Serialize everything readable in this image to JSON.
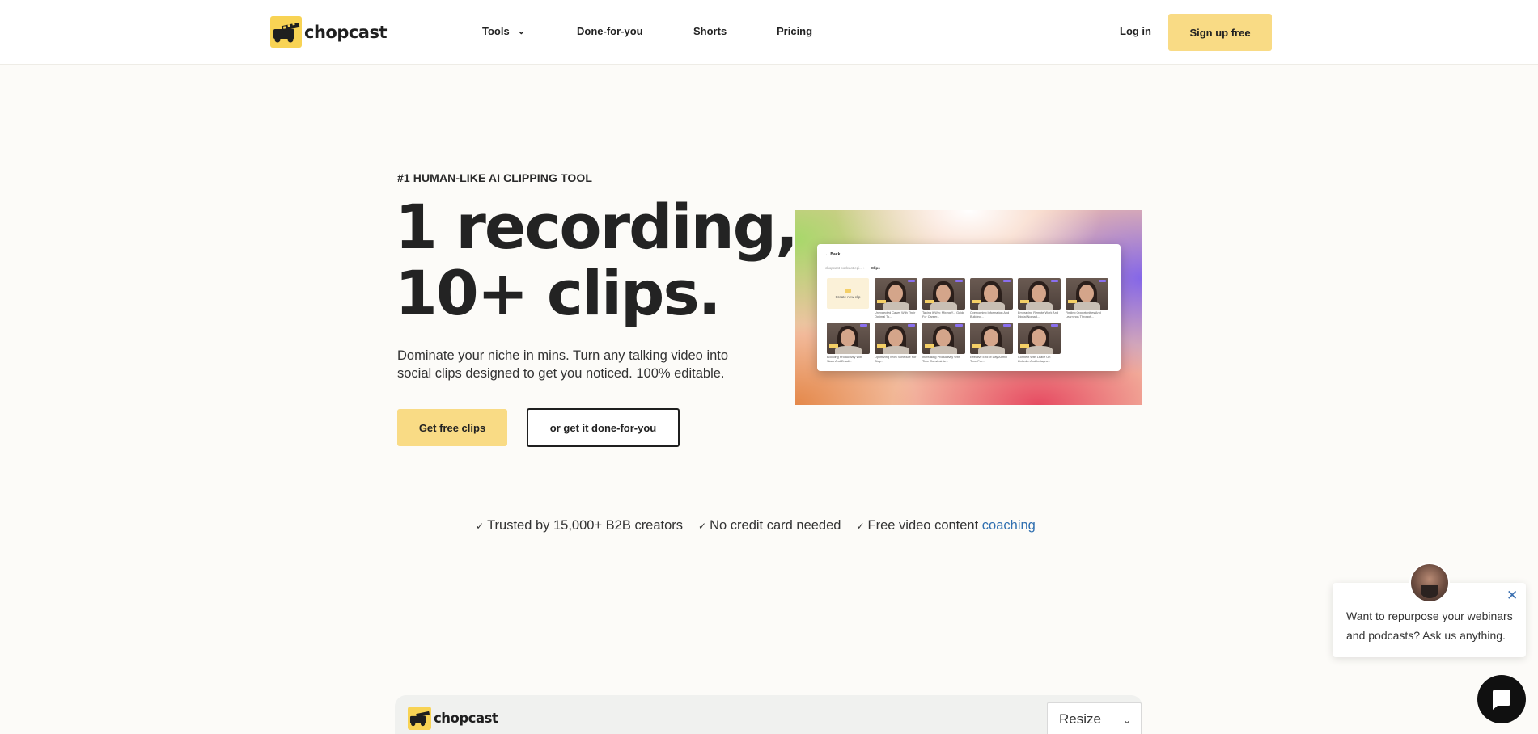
{
  "nav": {
    "brand": "chopcast",
    "links": [
      {
        "label": "Tools",
        "has_dropdown": true
      },
      {
        "label": "Done-for-you"
      },
      {
        "label": "Shorts"
      },
      {
        "label": "Pricing"
      }
    ],
    "login": "Log in",
    "signup": "Sign up free"
  },
  "hero": {
    "eyebrow": "#1 HUMAN-LIKE AI CLIPPING TOOL",
    "headline_line1": "1 recording,",
    "headline_line2": "10+ clips.",
    "subtitle": "Dominate your niche in mins. Turn any talking video into social clips designed to get you noticed. 100% editable.",
    "cta_primary": "Get free clips",
    "cta_secondary": "or get it done-for-you"
  },
  "hero_image": {
    "back": "Back",
    "crumb_parent": "chopcast podcast epi...",
    "crumb_current": "Clips",
    "create_clip": "Create new clip",
    "row1": [
      "Unexpected Cases With Their Optimal To...",
      "Taking It Win: Mixing Y... Guide For Career...",
      "Overcoming Information And Building...",
      "Embracing Remote Work And Digital Nomad...",
      "Finding Opportunities And Learnings Through..."
    ],
    "row2": [
      "Boosting Productivity With Slack And Email...",
      "Optimizing Work Schedule For Step...",
      "Increasing Productivity With Time Constraints...",
      "Effective End of Day Admin Time For...",
      "Connect With Leave On LinkedIn And Instagra..."
    ]
  },
  "trust": {
    "item1": "Trusted by 15,000+ B2B creators",
    "item2": "No credit card needed",
    "item3_prefix": "Free video content",
    "item3_link": "coaching"
  },
  "chat": {
    "message": "Want to repurpose your webinars and podcasts? Ask us anything."
  },
  "preview": {
    "brand": "chopcast",
    "resize_label": "Resize"
  },
  "colors": {
    "accent_yellow": "#f9db85",
    "link_blue": "#2f6fb0",
    "background": "#fcfbf8"
  }
}
